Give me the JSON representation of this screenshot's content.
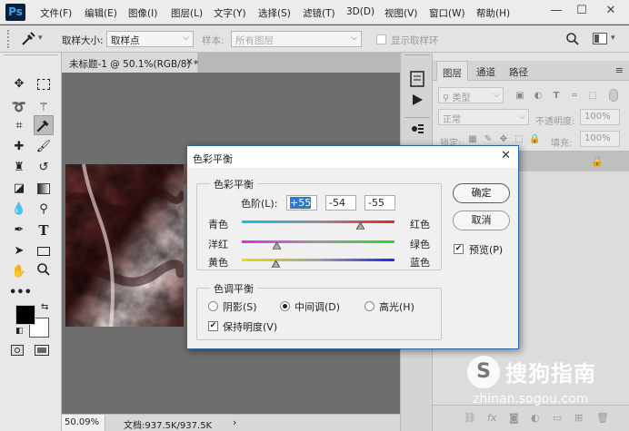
{
  "app": {
    "logo": "Ps",
    "menus": [
      "文件(F)",
      "编辑(E)",
      "图像(I)",
      "图层(L)",
      "文字(Y)",
      "选择(S)",
      "滤镜(T)",
      "3D(D)",
      "视图(V)",
      "窗口(W)",
      "帮助(H)"
    ],
    "window_controls": {
      "minimize": "—",
      "maximize": "☐",
      "close": "✕"
    }
  },
  "options_bar": {
    "sample_size_label": "取样大小:",
    "sample_size_value": "取样点",
    "sample_label": "样本:",
    "sample_value": "所有图层",
    "show_ring_label": "显示取样环"
  },
  "document": {
    "tab_title": "未标题-1 @ 50.1%(RGB/8) *",
    "tab_close": "×",
    "zoom": "50.09%",
    "doc_size": "文档:937.5K/937.5K",
    "status_arrow": "›"
  },
  "layers_panel": {
    "tabs": [
      "图层",
      "通道",
      "路径"
    ],
    "filter_kind": "类型",
    "blend_mode": "正常",
    "opacity_label": "不透明度:",
    "opacity_value": "100%",
    "lock_label": "锁定:",
    "fill_label": "填充:",
    "fill_value": "100%"
  },
  "dialog": {
    "title": "色彩平衡",
    "close": "✕",
    "balance_group": "色彩平衡",
    "levels_label": "色阶(L):",
    "levels": [
      "+55",
      "-54",
      "-55"
    ],
    "sliders": [
      {
        "left": "青色",
        "right": "红色",
        "value": 55
      },
      {
        "left": "洋红",
        "right": "绿色",
        "value": -54
      },
      {
        "left": "黄色",
        "right": "蓝色",
        "value": -55
      }
    ],
    "tone_group": "色调平衡",
    "tones": [
      {
        "label": "阴影(S)",
        "selected": false
      },
      {
        "label": "中间调(D)",
        "selected": true
      },
      {
        "label": "高光(H)",
        "selected": false
      }
    ],
    "preserve_luminosity": "保持明度(V)",
    "preserve_checked": true,
    "ok": "确定",
    "cancel": "取消",
    "preview": "预览(P)",
    "preview_checked": true
  },
  "watermark": {
    "logo": "S",
    "brand": "搜狗指南",
    "url": "zhinan.sogou.com"
  },
  "colors": {
    "selection": "#3377cc",
    "dialog_border": "#2a67b0",
    "canvas_bg": "#6e6e6e"
  }
}
